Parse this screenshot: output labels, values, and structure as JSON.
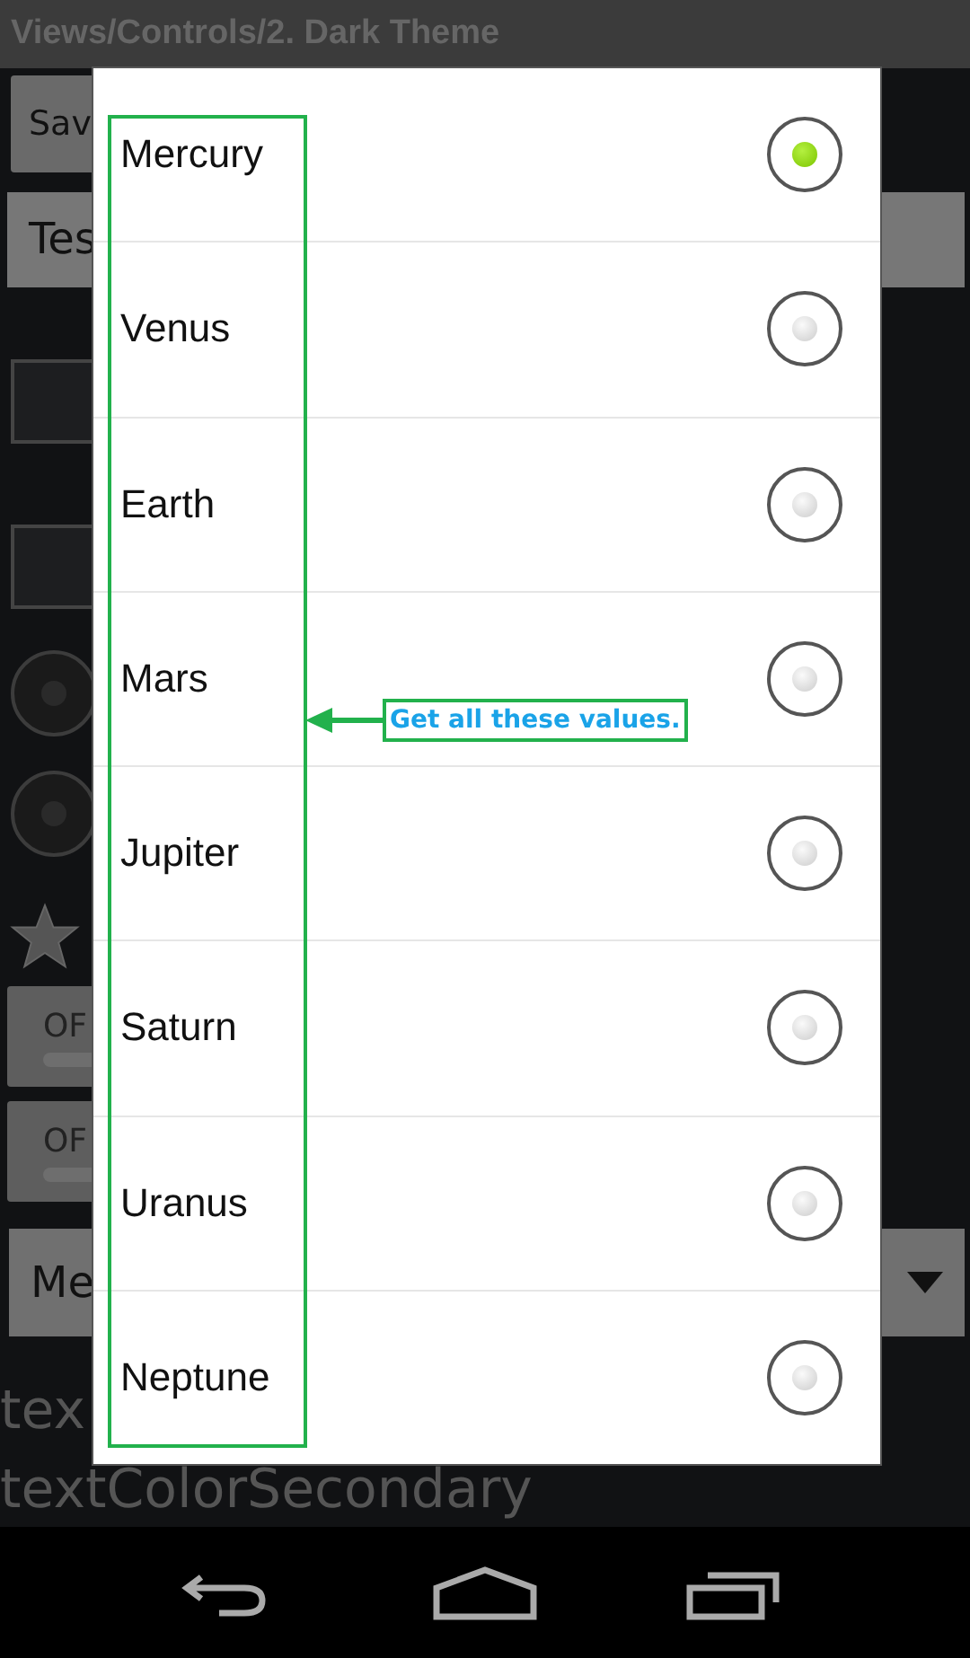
{
  "title_bar": {
    "title": "Views/Controls/2. Dark Theme"
  },
  "background": {
    "button": "Sav",
    "field_value": "Tes",
    "checkboxes": [
      {
        "checked": false
      },
      {
        "checked": false
      }
    ],
    "radios": [
      {
        "selected": false
      },
      {
        "selected": false
      }
    ],
    "star": {
      "on": false
    },
    "toggles": [
      {
        "label": "OF"
      },
      {
        "label": "OF"
      }
    ],
    "spinner": {
      "value": "Me"
    },
    "texts": [
      "tex",
      "textColorSecondary"
    ]
  },
  "dialog": {
    "items": [
      {
        "label": "Mercury",
        "selected": true
      },
      {
        "label": "Venus",
        "selected": false
      },
      {
        "label": "Earth",
        "selected": false
      },
      {
        "label": "Mars",
        "selected": false
      },
      {
        "label": "Jupiter",
        "selected": false
      },
      {
        "label": "Saturn",
        "selected": false
      },
      {
        "label": "Uranus",
        "selected": false
      },
      {
        "label": "Neptune",
        "selected": false
      }
    ]
  },
  "annotation": {
    "label": "Get all these values."
  }
}
